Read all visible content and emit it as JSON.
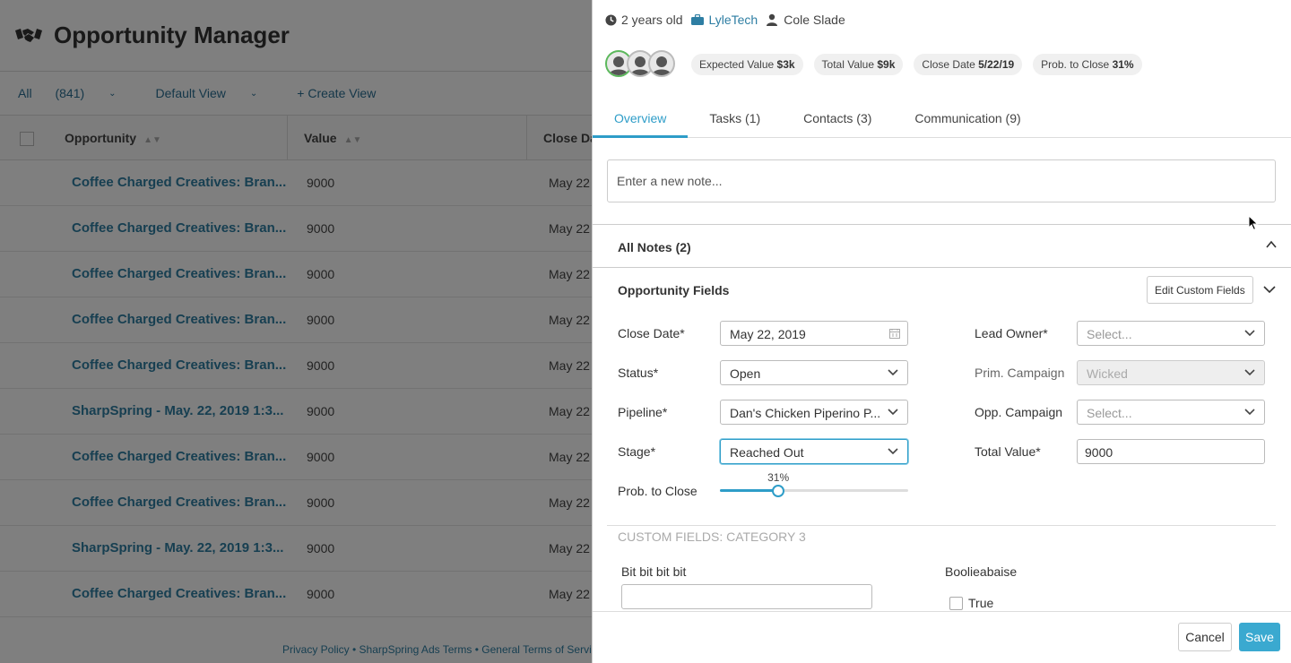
{
  "app": {
    "title": "Opportunity Manager"
  },
  "toolbar": {
    "all_label": "All",
    "all_count": "(841)",
    "view_label": "Default View",
    "create_view": "+ Create View"
  },
  "table": {
    "columns": [
      "Opportunity",
      "Value",
      "Close Da"
    ],
    "rows": [
      {
        "name": "Coffee Charged Creatives: Bran...",
        "value": "9000",
        "date": "May 22"
      },
      {
        "name": "Coffee Charged Creatives: Bran...",
        "value": "9000",
        "date": "May 22"
      },
      {
        "name": "Coffee Charged Creatives: Bran...",
        "value": "9000",
        "date": "May 22"
      },
      {
        "name": "Coffee Charged Creatives: Bran...",
        "value": "9000",
        "date": "May 22"
      },
      {
        "name": "Coffee Charged Creatives: Bran...",
        "value": "9000",
        "date": "May 22"
      },
      {
        "name": "SharpSpring - May. 22, 2019 1:3...",
        "value": "9000",
        "date": "May 22"
      },
      {
        "name": "Coffee Charged Creatives: Bran...",
        "value": "9000",
        "date": "May 22"
      },
      {
        "name": "Coffee Charged Creatives: Bran...",
        "value": "9000",
        "date": "May 22"
      },
      {
        "name": "SharpSpring - May. 22, 2019 1:3...",
        "value": "9000",
        "date": "May 22"
      },
      {
        "name": "Coffee Charged Creatives: Bran...",
        "value": "9000",
        "date": "May 22"
      }
    ]
  },
  "footer": {
    "links": "Privacy Policy • SharpSpring Ads Terms • General Terms of Service"
  },
  "drawer": {
    "meta": {
      "age": "2 years old",
      "company": "LyleTech",
      "owner": "Cole Slade"
    },
    "pills": [
      {
        "label": "Expected Value",
        "value": "$3k"
      },
      {
        "label": "Total Value",
        "value": "$9k"
      },
      {
        "label": "Close Date",
        "value": "5/22/19"
      },
      {
        "label": "Prob. to Close",
        "value": "31%"
      }
    ],
    "tabs": [
      "Overview",
      "Tasks (1)",
      "Contacts (3)",
      "Communication (9)"
    ],
    "note_placeholder": "Enter a new note...",
    "all_notes": "All Notes (2)",
    "opp_fields_title": "Opportunity Fields",
    "edit_custom": "Edit Custom Fields",
    "fields": {
      "close_date": {
        "label": "Close Date*",
        "value": "May 22, 2019"
      },
      "status": {
        "label": "Status*",
        "value": "Open"
      },
      "pipeline": {
        "label": "Pipeline*",
        "value": "Dan's Chicken Piperino P..."
      },
      "stage": {
        "label": "Stage*",
        "value": "Reached Out"
      },
      "prob": {
        "label": "Prob. to Close",
        "value": "31%",
        "fraction": 0.31
      },
      "lead_owner": {
        "label": "Lead Owner*",
        "value": "Select..."
      },
      "prim_campaign": {
        "label": "Prim. Campaign",
        "value": "Wicked"
      },
      "opp_campaign": {
        "label": "Opp. Campaign",
        "value": "Select..."
      },
      "total_value": {
        "label": "Total Value*",
        "value": "9000"
      }
    },
    "custom": {
      "title": "CUSTOM FIELDS: CATEGORY 3",
      "bit_label": "Bit bit bit bit",
      "bool_label": "Boolieabaise",
      "true_label": "True"
    },
    "buttons": {
      "cancel": "Cancel",
      "save": "Save"
    }
  },
  "colors": {
    "accent": "#2e9dc8",
    "link": "#2e7ea3",
    "save": "#3aa9d0"
  }
}
